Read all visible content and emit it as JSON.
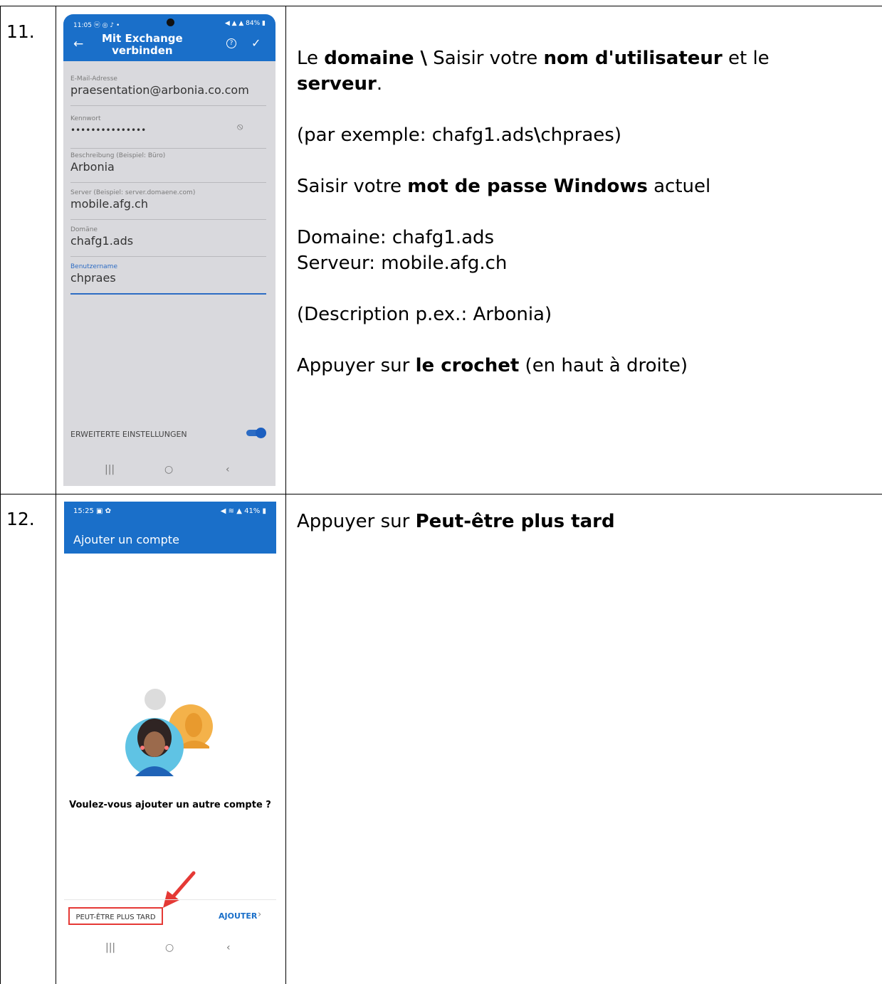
{
  "steps": [
    {
      "number": "11.",
      "phone": {
        "status_time": "11:05 ⓦ ◎ ♪ •",
        "status_right": "◀ ▲ ▲ 84% ▮",
        "title_line1": "Mit Exchange",
        "title_line2": "verbinden",
        "fields": [
          {
            "label": "E-Mail-Adresse",
            "value": "praesentation@arbonia.co.com"
          },
          {
            "label": "Kennwort",
            "value": "•••••••••••••••"
          },
          {
            "label": "Beschreibung (Beispiel: Büro)",
            "value": "Arbonia"
          },
          {
            "label": "Server (Beispiel: server.domaene.com)",
            "value": "mobile.afg.ch"
          },
          {
            "label": "Domäne",
            "value": "chafg1.ads"
          },
          {
            "label": "Benutzername",
            "value": "chpraes"
          }
        ],
        "advanced_label": "ERWEITERTE EINSTELLUNGEN",
        "advanced_enabled": true
      },
      "text": {
        "l1_a": "Le ",
        "l1_b": "domaine \\",
        "l1_c": " Saisir votre ",
        "l1_d": "nom d'utilisateur",
        "l1_e": " et le",
        "l2_a": "serveur",
        "l2_b": ".",
        "l3_a": "(par exemple: chafg1.ads",
        "l3_b": "\\",
        "l3_c": "chpraes)",
        "l4_a": "Saisir votre ",
        "l4_b": "mot de passe Windows",
        "l4_c": " actuel",
        "l5": "Domaine: chafg1.ads",
        "l6": "Serveur: mobile.afg.ch",
        "l7": "(Description p.ex.: Arbonia)",
        "l8_a": "Appuyer sur ",
        "l8_b": "le crochet",
        "l8_c": " (en haut à droite)"
      }
    },
    {
      "number": "12.",
      "phone": {
        "status_time": "15:25 ▣ ✿",
        "status_right": "◀ ≋ ▲ 41% ▮",
        "title": "Ajouter un compte",
        "question": "Voulez-vous ajouter un autre compte ?",
        "later_button": "PEUT-ÊTRE PLUS TARD",
        "add_button": "AJOUTER"
      },
      "text": {
        "l1_a": "Appuyer sur ",
        "l1_b": "Peut-être plus tard"
      }
    }
  ],
  "colors": {
    "header_blue": "#1a6fc9",
    "highlight_red": "#e53935",
    "arrow_red": "#e53935"
  }
}
